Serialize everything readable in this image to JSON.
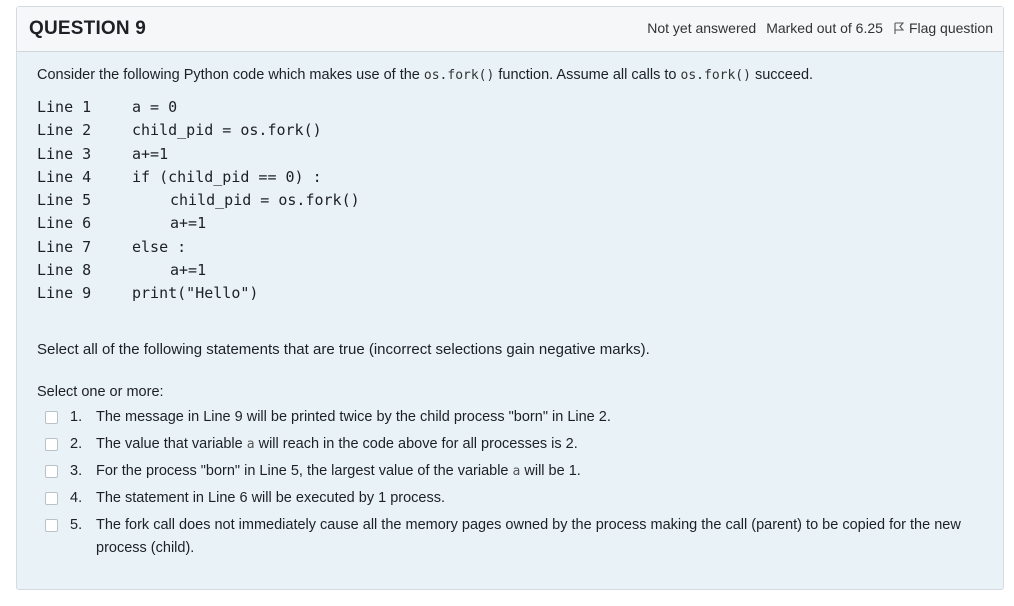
{
  "question": {
    "title": "QUESTION 9",
    "status": "Not yet answered",
    "marks": "Marked out of 6.25",
    "flag_label": "Flag question"
  },
  "intro": {
    "before": "Consider the following Python code which makes use of the ",
    "code1": "os.fork()",
    "middle": " function. Assume all calls to ",
    "code2": "os.fork()",
    "after": " succeed."
  },
  "code_lines": [
    {
      "num": "Line 1",
      "code": "a = 0",
      "indent": 0
    },
    {
      "num": "Line 2",
      "code": "child_pid = os.fork()",
      "indent": 0
    },
    {
      "num": "Line 3",
      "code": "a+=1",
      "indent": 0
    },
    {
      "num": "Line 4",
      "code": "if (child_pid == 0) :",
      "indent": 0
    },
    {
      "num": "Line 5",
      "code": "child_pid = os.fork()",
      "indent": 1
    },
    {
      "num": "Line 6",
      "code": "a+=1",
      "indent": 1
    },
    {
      "num": "Line 7",
      "code": "else :",
      "indent": 0
    },
    {
      "num": "Line 8",
      "code": "a+=1",
      "indent": 1
    },
    {
      "num": "Line 9",
      "code": "print(\"Hello\")",
      "indent": 0
    }
  ],
  "statement": "Select all of the following statements that are true (incorrect selections gain negative marks).",
  "select_prompt": "Select one or more:",
  "options": [
    {
      "num": "1.",
      "text": "The message in Line 9 will be printed twice by the child process \"born\" in Line 2."
    },
    {
      "num": "2.",
      "text_before": "The value that variable ",
      "code": "a",
      "text_after": " will reach in the code above for all processes is 2."
    },
    {
      "num": "3.",
      "text_before": "For the process \"born\" in Line 5, the largest value of the variable ",
      "code": "a",
      "text_after": " will be 1."
    },
    {
      "num": "4.",
      "text": "The statement in Line 6 will be executed by 1 process."
    },
    {
      "num": "5.",
      "text": "The fork call does not immediately cause all the memory pages owned by the process making the call (parent) to be copied for the new process (child)."
    }
  ],
  "colors": {
    "card_bg": "#e9f2f7",
    "header_bg": "#f6f7f8"
  }
}
